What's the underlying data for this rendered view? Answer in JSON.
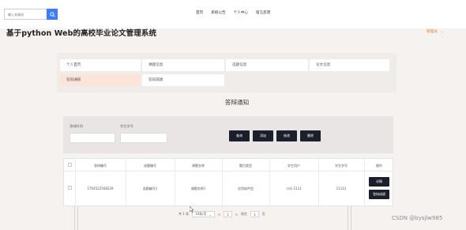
{
  "header": {
    "search_placeholder": "输入关键词",
    "nav": [
      "首页",
      "系统公告",
      "个人中心",
      "留言反馈"
    ],
    "user_menu": "管理员"
  },
  "page_title": "基于python Web的高校毕业论文管理系统",
  "menu": {
    "items": [
      "个人首页",
      "课题信息",
      "选题信息",
      "论文信息",
      "答辩通知",
      "答辩成绩"
    ],
    "active_index": 4
  },
  "section_title": "答辩通知",
  "filters": {
    "labels": [
      "答辩时间",
      "学生学号"
    ],
    "buttons": [
      "查询",
      "添加",
      "修改",
      "删除"
    ]
  },
  "table": {
    "headers": [
      "答辩编号",
      "选题编号",
      "课题名称",
      "题目类型",
      "学生用户",
      "学生学号",
      "操作"
    ],
    "rows": [
      [
        "1704522568229",
        "选题编号1",
        "课题名称1",
        "应用软件型",
        "小乐-1111",
        "11111"
      ]
    ],
    "row_actions": [
      "详情",
      "答辩成绩"
    ]
  },
  "pagination": {
    "total": "共 1 条",
    "page_size": "10条/页",
    "prev": "<",
    "current": "1",
    "next": ">",
    "goto_label": "前往",
    "goto_value": "1",
    "page_suffix": "页"
  },
  "watermark": "CSDN @bysjlw985",
  "colors": {
    "accent": "#3a7bff",
    "active_menu": "#fbe5d9",
    "dark_button": "#1b1f2b",
    "user_menu": "#e07b39"
  }
}
